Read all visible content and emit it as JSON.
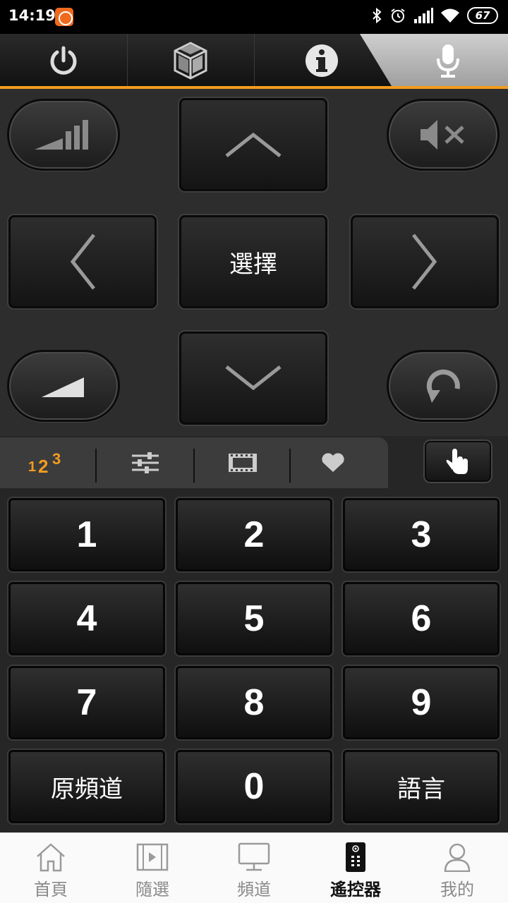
{
  "status_bar": {
    "time": "14:19",
    "battery": "67"
  },
  "toolbar": {
    "items": [
      {
        "id": "power",
        "icon": "power-icon"
      },
      {
        "id": "box",
        "icon": "cube-icon"
      },
      {
        "id": "info",
        "icon": "info-icon"
      },
      {
        "id": "mic",
        "icon": "mic-icon"
      }
    ]
  },
  "nav_pad": {
    "select_label": "選擇"
  },
  "tabs": {
    "items": [
      {
        "icon": "numbers-icon",
        "label": "123",
        "active": true
      },
      {
        "icon": "sliders-icon"
      },
      {
        "icon": "film-icon"
      },
      {
        "icon": "heart-icon"
      }
    ],
    "touch_icon": "touch-icon"
  },
  "keypad": {
    "keys": [
      "1",
      "2",
      "3",
      "4",
      "5",
      "6",
      "7",
      "8",
      "9",
      "原頻道",
      "0",
      "語言"
    ]
  },
  "bottom_nav": {
    "items": [
      {
        "label": "首頁",
        "icon": "home-icon"
      },
      {
        "label": "隨選",
        "icon": "video-icon"
      },
      {
        "label": "頻道",
        "icon": "tv-icon"
      },
      {
        "label": "遙控器",
        "icon": "remote-icon",
        "active": true
      },
      {
        "label": "我的",
        "icon": "user-icon"
      }
    ]
  },
  "colors": {
    "accent": "#f39c1f",
    "bg": "#2d2d2d"
  }
}
